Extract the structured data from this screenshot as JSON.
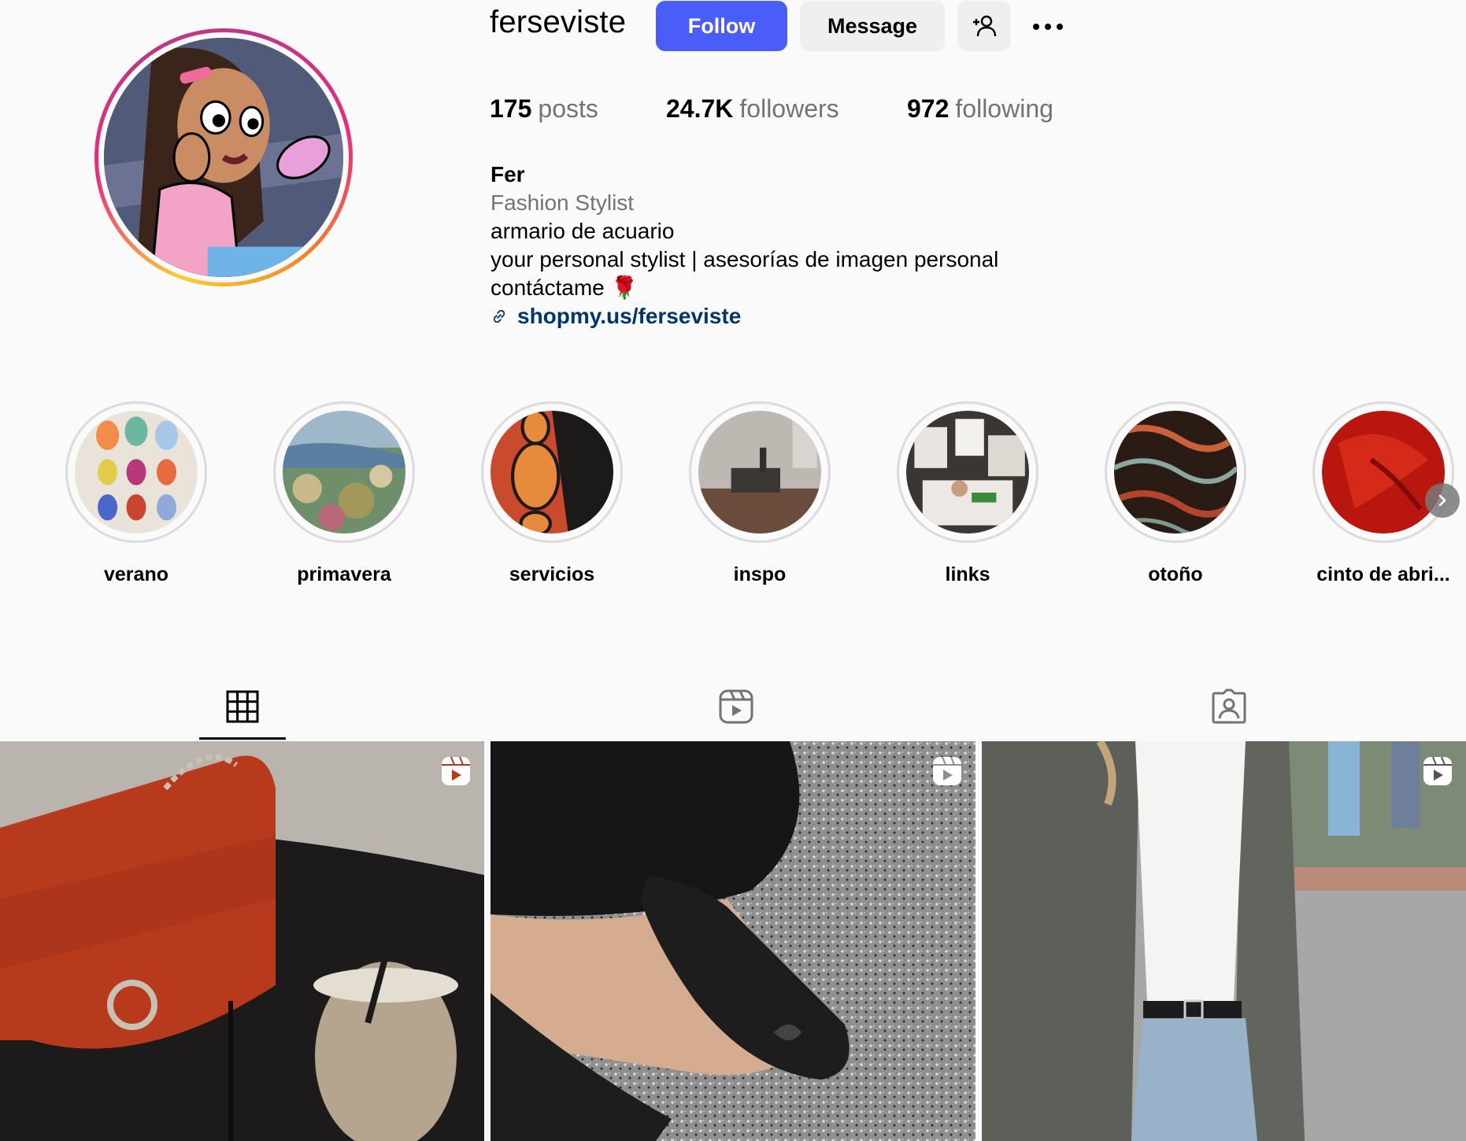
{
  "profile": {
    "username": "ferseviste",
    "follow_label": "Follow",
    "message_label": "Message",
    "add_user_icon": "person-plus-icon",
    "more_icon": "more-horizontal-icon",
    "avatar_icon": "profile-avatar"
  },
  "stats": {
    "posts_count": "175",
    "posts_label": "posts",
    "followers_count": "24.7K",
    "followers_label": "followers",
    "following_count": "972",
    "following_label": "following"
  },
  "bio": {
    "name": "Fer",
    "category": "Fashion Stylist",
    "line1": "armario de acuario",
    "line2": "your personal stylist | asesorías de imagen personal",
    "line3": "contáctame 🌹",
    "link_icon": "link-icon",
    "link": "shopmy.us/ferseviste"
  },
  "highlights": [
    {
      "label": "verano"
    },
    {
      "label": "primavera"
    },
    {
      "label": "servicios"
    },
    {
      "label": "inspo"
    },
    {
      "label": "links"
    },
    {
      "label": "otoño"
    },
    {
      "label": "cinto de abri..."
    }
  ],
  "tabs": [
    {
      "icon": "grid-icon",
      "active": true
    },
    {
      "icon": "reels-icon",
      "active": false
    },
    {
      "icon": "tagged-icon",
      "active": false
    }
  ],
  "posts": [
    {
      "type": "reel",
      "badge_icon": "reel-icon"
    },
    {
      "type": "reel",
      "badge_icon": "reel-icon"
    },
    {
      "type": "reel",
      "badge_icon": "reel-icon"
    }
  ],
  "colors": {
    "follow_button": "#4a5df9",
    "secondary_button": "#efefef",
    "link": "#00376b",
    "muted_text": "#737373",
    "background": "#fafafa"
  }
}
